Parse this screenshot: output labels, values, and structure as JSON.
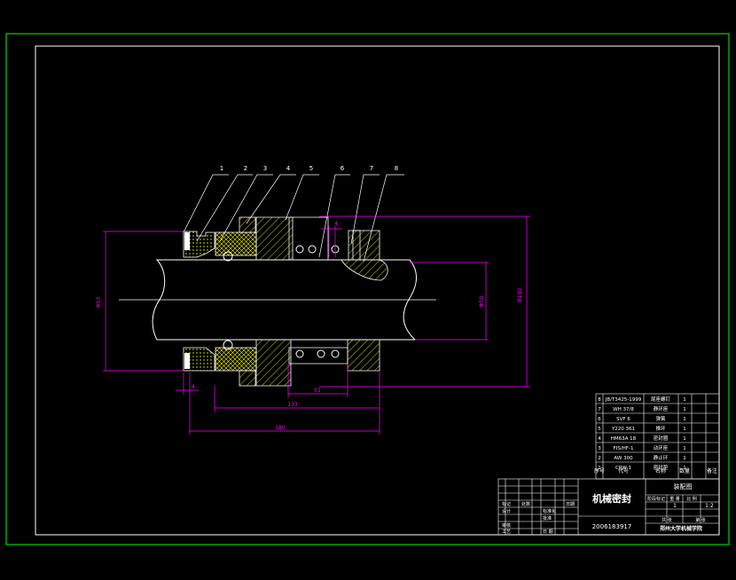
{
  "drawing": {
    "balloons": [
      "1",
      "2",
      "3",
      "4",
      "5",
      "6",
      "7",
      "8"
    ],
    "dimensions": {
      "left_diameter": "Φ53",
      "shaft_diameter": "Φ50",
      "right_diameter": "Φ130",
      "gap_4_top": "4",
      "gap_4_bottom": "4",
      "length_51": "51",
      "length_133": "133",
      "length_180": "180"
    }
  },
  "parts_list": {
    "rows": [
      {
        "no": "8",
        "code": "JB/T3425-1999",
        "name": "尾座螺钉",
        "qty": "1"
      },
      {
        "no": "7",
        "code": "WH 37/8",
        "name": "静环座",
        "qty": "1"
      },
      {
        "no": "6",
        "code": "SVF 6",
        "name": "弹簧",
        "qty": "1"
      },
      {
        "no": "5",
        "code": "Y220 361",
        "name": "推环",
        "qty": "1"
      },
      {
        "no": "4",
        "code": "HM63A 18",
        "name": "密封圈",
        "qty": "1"
      },
      {
        "no": "3",
        "code": "FIS/HF-1",
        "name": "动环座",
        "qty": "1"
      },
      {
        "no": "2",
        "code": "AW 300",
        "name": "静止环",
        "qty": "1"
      },
      {
        "no": "1",
        "code": "CRW 1",
        "name": "密封垫",
        "qty": "1"
      }
    ],
    "header": {
      "no": "序号",
      "code": "代号",
      "name": "名称",
      "qty": "数量",
      "note": "备注"
    }
  },
  "title_block": {
    "title": "机械密封",
    "drawing_no": "2006183917",
    "school": "郑州大学机械学院",
    "part_label": "装配图",
    "scale": "1:2",
    "qty": "1",
    "col_stage": "阶段标记",
    "col_weight": "重 量",
    "col_scale": "比 例",
    "col_sheets": "共  张",
    "col_sheet": "第  张",
    "left_rows": [
      "标记",
      "设计",
      "审核",
      "工艺"
    ],
    "mid_labels": [
      "处数",
      "标准化",
      "批准",
      "日期"
    ],
    "date_label": "日 期"
  },
  "colors": {
    "frame": "#00ff00",
    "outline": "#ffffff",
    "dimension": "#ff00ff",
    "hatch": "#ffff00"
  }
}
